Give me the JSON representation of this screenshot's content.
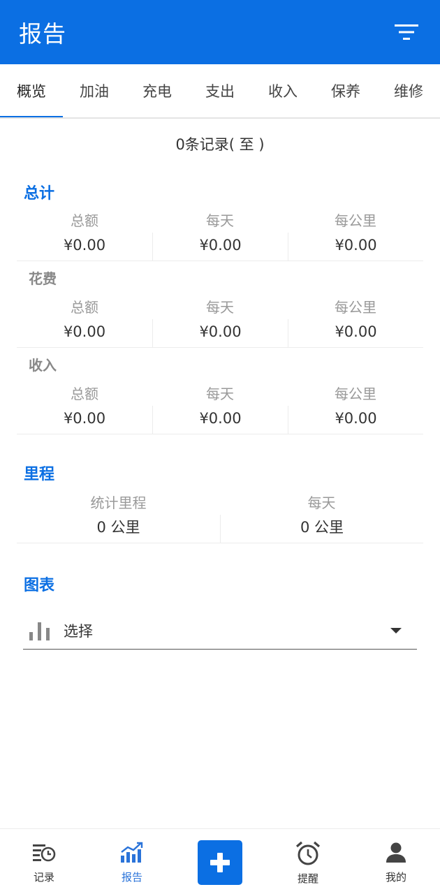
{
  "header": {
    "title": "报告",
    "filter_icon": "filter-icon"
  },
  "tabs": [
    {
      "label": "概览",
      "active": true
    },
    {
      "label": "加油"
    },
    {
      "label": "充电"
    },
    {
      "label": "支出"
    },
    {
      "label": "收入"
    },
    {
      "label": "保养"
    },
    {
      "label": "维修"
    }
  ],
  "summary": {
    "records_text": "0条记录( 至 )"
  },
  "totals": {
    "title": "总计",
    "overall": {
      "labels": [
        "总额",
        "每天",
        "每公里"
      ],
      "values": [
        "¥0.00",
        "¥0.00",
        "¥0.00"
      ]
    },
    "expense": {
      "title": "花费",
      "labels": [
        "总额",
        "每天",
        "每公里"
      ],
      "values": [
        "¥0.00",
        "¥0.00",
        "¥0.00"
      ]
    },
    "income": {
      "title": "收入",
      "labels": [
        "总额",
        "每天",
        "每公里"
      ],
      "values": [
        "¥0.00",
        "¥0.00",
        "¥0.00"
      ]
    }
  },
  "mileage": {
    "title": "里程",
    "labels": [
      "统计里程",
      "每天"
    ],
    "values": [
      "0 公里",
      "0 公里"
    ]
  },
  "chart": {
    "title": "图表",
    "select_text": "选择",
    "icon": "bar-chart-icon"
  },
  "bottom_nav": [
    {
      "label": "记录",
      "icon": "records-icon"
    },
    {
      "label": "报告",
      "icon": "report-icon",
      "active": true
    },
    {
      "label": "",
      "icon": "add-icon"
    },
    {
      "label": "提醒",
      "icon": "alarm-icon"
    },
    {
      "label": "我的",
      "icon": "person-icon"
    }
  ],
  "colors": {
    "primary": "#0b6fe3",
    "muted_text": "#999999",
    "divider": "#ececec"
  }
}
